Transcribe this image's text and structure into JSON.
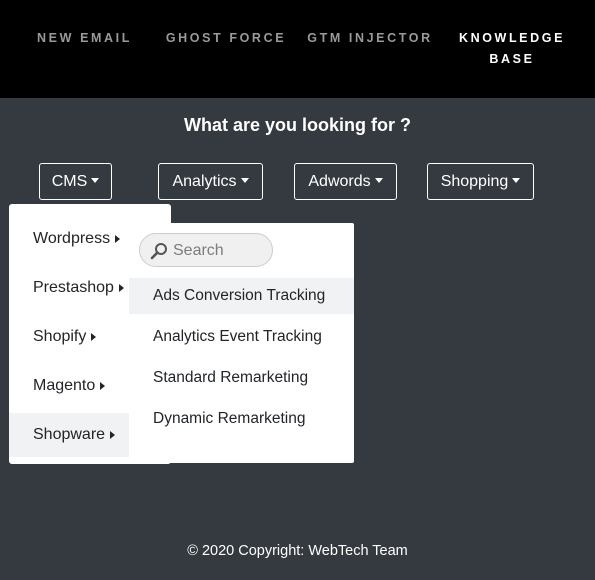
{
  "nav": {
    "items": [
      {
        "label": "NEW EMAIL"
      },
      {
        "label": "GHOST FORCE"
      },
      {
        "label": "GTM INJECTOR"
      },
      {
        "label_line1": "KNOWLEDGE",
        "label_line2": "BASE"
      }
    ]
  },
  "question": "What are you looking for ?",
  "dropdowns": {
    "cms": "CMS",
    "analytics": "Analytics",
    "adwords": "Adwords",
    "shopping": "Shopping"
  },
  "cms_menu": {
    "items": [
      "Wordpress",
      "Prestashop",
      "Shopify",
      "Magento",
      "Shopware"
    ],
    "active_item": "Shopware"
  },
  "submenu": {
    "search_placeholder": "Search",
    "items": [
      "Ads Conversion Tracking",
      "Analytics Event Tracking",
      "Standard Remarketing",
      "Dynamic Remarketing"
    ],
    "active_item": "Ads Conversion Tracking"
  },
  "footer": "© 2020 Copyright: WebTech Team",
  "colors": {
    "nav_bg": "#000000",
    "page_bg": "#343a40",
    "menu_bg": "#ffffff",
    "active_bg": "#f1f2f3",
    "nav_inactive": "#9a9a9a"
  }
}
